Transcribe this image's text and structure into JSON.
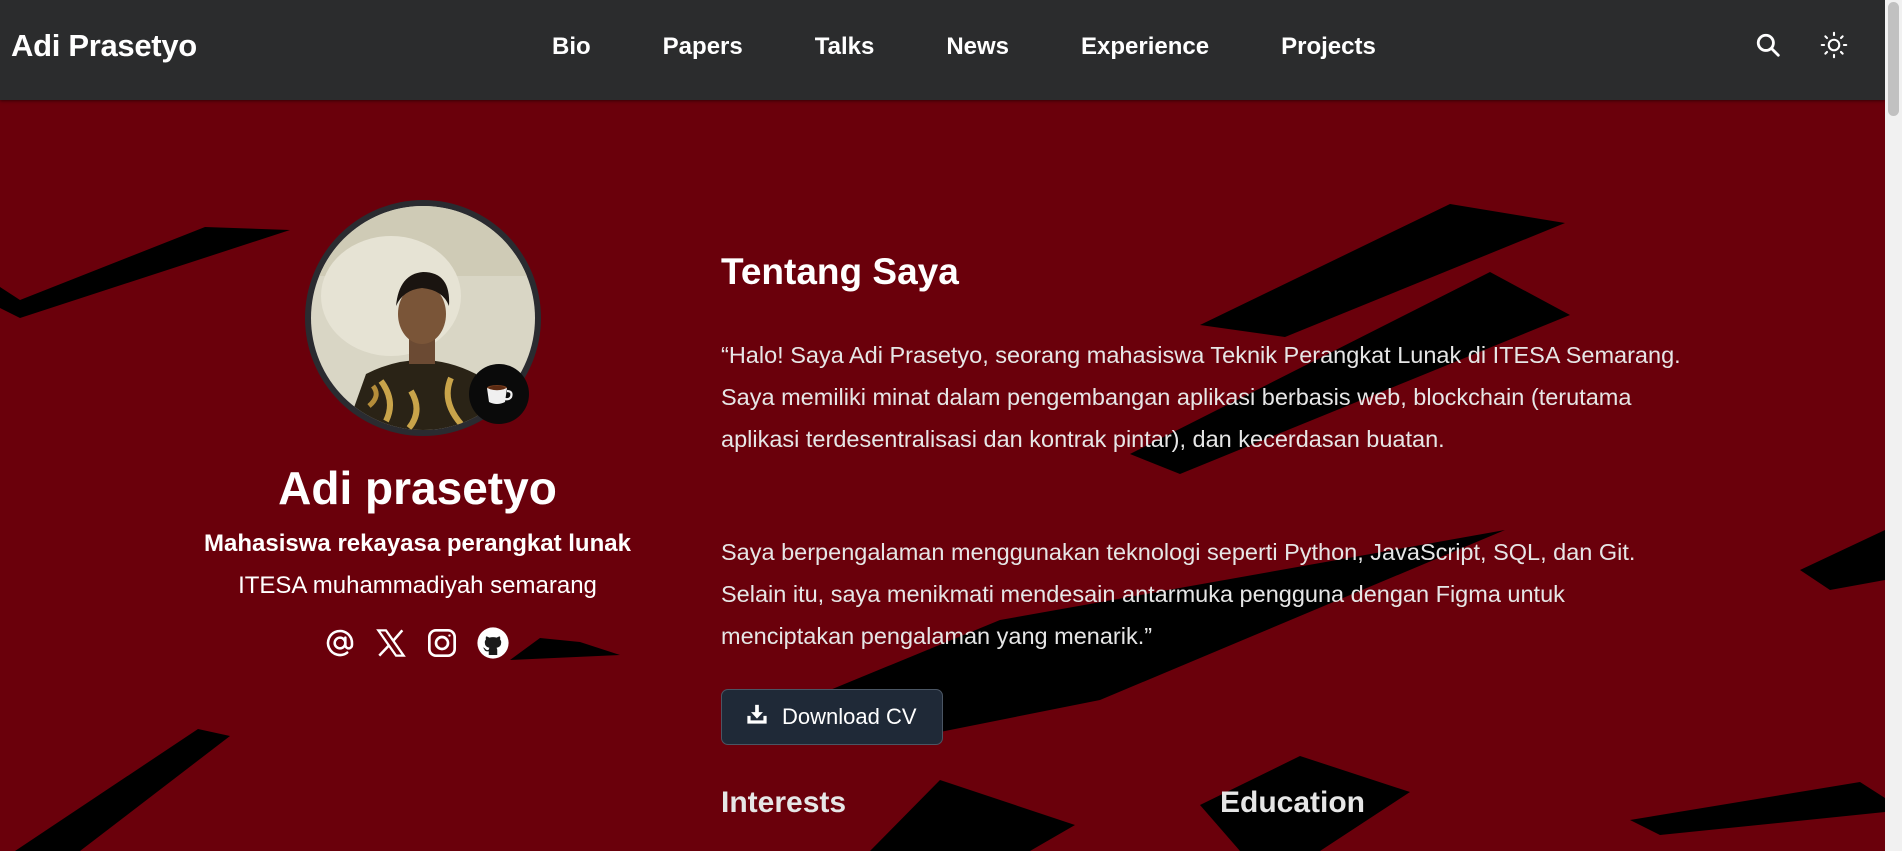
{
  "navbar": {
    "brand": "Adi Prasetyo",
    "links": [
      "Bio",
      "Papers",
      "Talks",
      "News",
      "Experience",
      "Projects"
    ],
    "search_icon": "search-icon",
    "theme_icon": "sun-icon"
  },
  "profile": {
    "name": "Adi prasetyo",
    "role": "Mahasiswa rekayasa perangkat lunak",
    "organization": "ITESA muhammadiyah semarang",
    "status_emoji": "☕",
    "socials": [
      "at-sign-icon",
      "x-twitter-icon",
      "instagram-icon",
      "github-icon"
    ]
  },
  "about": {
    "title": "Tentang Saya",
    "paragraph1": "“Halo! Saya Adi Prasetyo, seorang mahasiswa Teknik Perangkat Lunak di ITESA Semarang. Saya memiliki minat dalam pengembangan aplikasi berbasis web, blockchain (terutama aplikasi terdesentralisasi dan kontrak pintar), dan kecerdasan buatan.",
    "paragraph2": "Saya berpengalaman menggunakan teknologi seperti Python, JavaScript, SQL, dan Git. Selain itu, saya menikmati mendesain antarmuka pengguna dengan Figma untuk menciptakan pengalaman yang menarik.”",
    "download_label": "Download CV",
    "interests_heading": "Interests",
    "education_heading": "Education"
  },
  "colors": {
    "navbar_bg": "#2b2c2d",
    "page_bg": "#6a000b",
    "button_bg": "#1f2937",
    "shape": "#000000"
  }
}
